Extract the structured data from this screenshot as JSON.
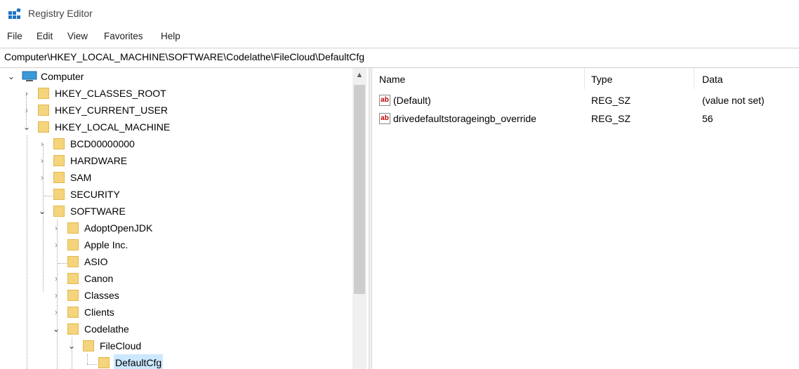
{
  "window": {
    "title": "Registry Editor",
    "icon": "registry-editor-icon"
  },
  "menu": [
    "File",
    "Edit",
    "View",
    "Favorites",
    "Help"
  ],
  "address": "Computer\\HKEY_LOCAL_MACHINE\\SOFTWARE\\Codelathe\\FileCloud\\DefaultCfg",
  "tree": {
    "root": "Computer",
    "items": [
      "HKEY_CLASSES_ROOT",
      "HKEY_CURRENT_USER",
      "HKEY_LOCAL_MACHINE",
      "BCD00000000",
      "HARDWARE",
      "SAM",
      "SECURITY",
      "SOFTWARE",
      "AdoptOpenJDK",
      "Apple Inc.",
      "ASIO",
      "Canon",
      "Classes",
      "Clients",
      "Codelathe",
      "FileCloud",
      "DefaultCfg"
    ],
    "chevrons": {
      "collapsed": "›",
      "expanded": "⌄",
      "scroll_up": "▲"
    }
  },
  "list": {
    "columns": {
      "name": "Name",
      "type": "Type",
      "data": "Data"
    },
    "rows": [
      {
        "name": "(Default)",
        "type": "REG_SZ",
        "data": "(value not set)",
        "icon": "string-value-icon"
      },
      {
        "name": "drivedefaultstorageingb_override",
        "type": "REG_SZ",
        "data": "56",
        "icon": "string-value-icon"
      }
    ],
    "icon_glyph": "ab"
  },
  "colors": {
    "selection": "#cce8ff",
    "folder": "#f4d47c",
    "accent": "#0078d7"
  }
}
